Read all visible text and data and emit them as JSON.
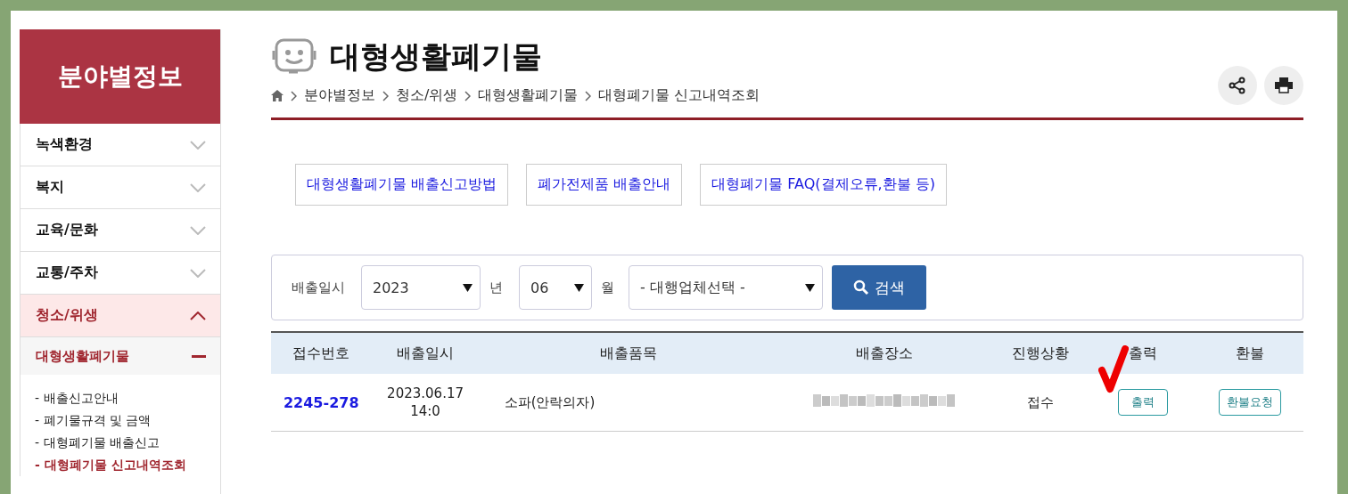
{
  "sidebar": {
    "title": "분야별정보",
    "items": [
      {
        "label": "녹색환경",
        "expanded": false
      },
      {
        "label": "복지",
        "expanded": false
      },
      {
        "label": "교육/문화",
        "expanded": false
      },
      {
        "label": "교통/주차",
        "expanded": false
      },
      {
        "label": "청소/위생",
        "expanded": true,
        "submenu": {
          "label": "대형생활폐기물",
          "links": [
            {
              "label": "- 배출신고안내",
              "selected": false
            },
            {
              "label": "- 폐기물규격 및 금액",
              "selected": false
            },
            {
              "label": "- 대형폐기물 배출신고",
              "selected": false
            },
            {
              "label": "- 대형폐기물 신고내역조회",
              "selected": true
            }
          ]
        }
      }
    ]
  },
  "page": {
    "title": "대형생활폐기물",
    "breadcrumb": [
      "분야별정보",
      "청소/위생",
      "대형생활폐기물",
      "대형폐기물 신고내역조회"
    ]
  },
  "guide_links": [
    "대형생활폐기물 배출신고방법",
    "폐가전제품 배출안내",
    "대형폐기물 FAQ(결제오류,환불 등)"
  ],
  "search": {
    "label": "배출일시",
    "year": "2023",
    "year_unit": "년",
    "month": "06",
    "month_unit": "월",
    "company": "- 대행업체선택 -",
    "button": "검색"
  },
  "table": {
    "columns": [
      "접수번호",
      "배출일시",
      "배출품목",
      "배출장소",
      "진행상황",
      "출력",
      "환불"
    ],
    "rows": [
      {
        "number": "2245-278",
        "date": "2023.06.17",
        "time": "14:0",
        "item": "소파(안락의자)",
        "status": "접수",
        "print_button": "출력",
        "refund_button": "환불요청"
      }
    ]
  }
}
